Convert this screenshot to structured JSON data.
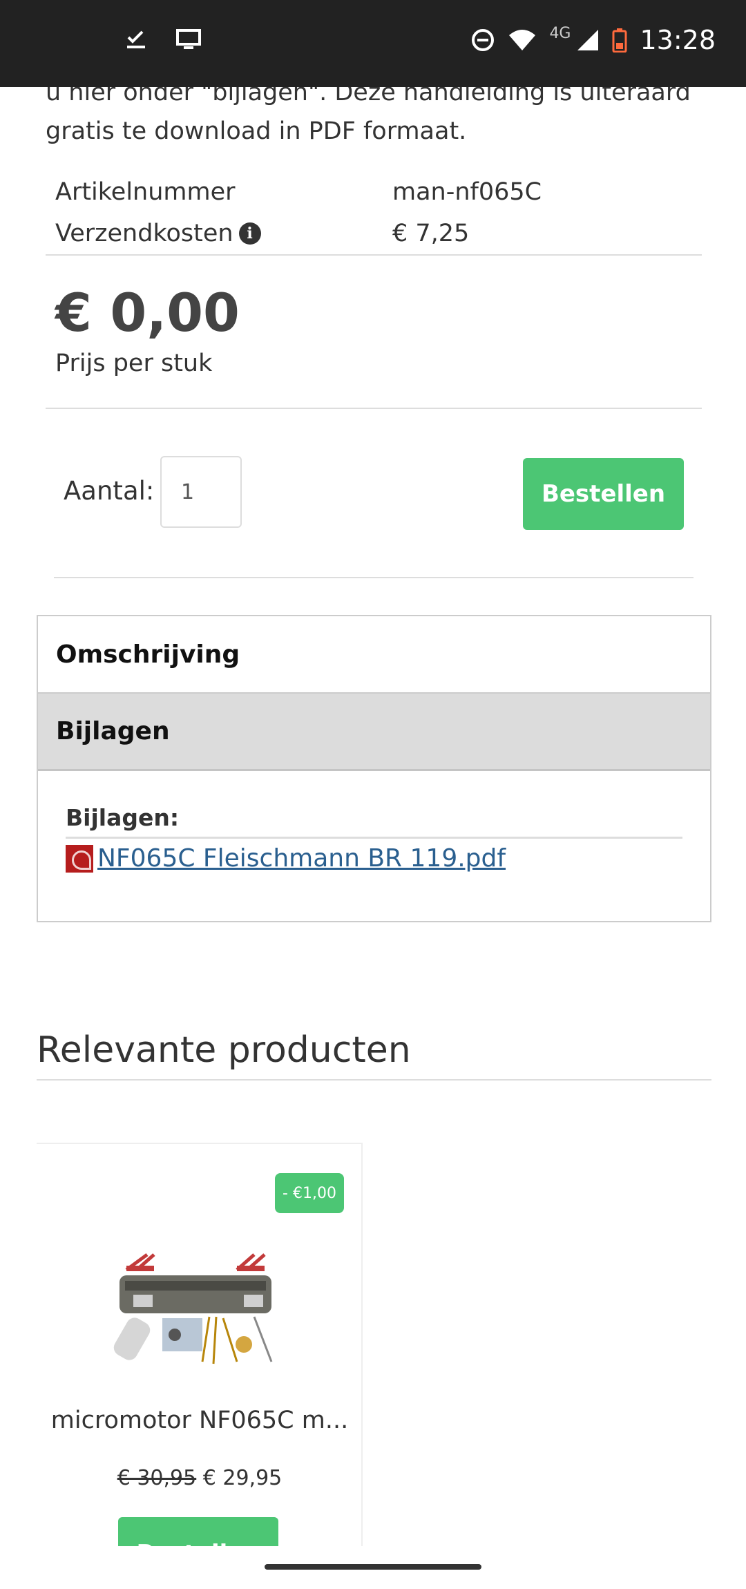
{
  "status_bar": {
    "time": "13:28",
    "network": "4G",
    "left_icons": [
      "check-download-icon",
      "screen-cast-icon"
    ],
    "right_icons": [
      "do-not-disturb-icon",
      "wifi-icon",
      "signal-icon",
      "battery-icon"
    ]
  },
  "intro": {
    "text": "u hier onder \"bijlagen\". Deze handleiding is uiteraard gratis te download in PDF formaat."
  },
  "specs": [
    {
      "label": "Artikelnummer",
      "value": "man-nf065C"
    },
    {
      "label": "Verzendkosten",
      "value": "€ 7,25"
    }
  ],
  "pricing": {
    "price": "€ 0,00",
    "subtitle": "Prijs per stuk"
  },
  "order": {
    "qty_label": "Aantal:",
    "qty_value": "1",
    "button_label": "Bestellen"
  },
  "tabs": {
    "description": "Omschrijving",
    "attachments": "Bijlagen"
  },
  "attachments": {
    "title": "Bijlagen:",
    "files": [
      "NF065C Fleischmann BR 119.pdf"
    ]
  },
  "related": {
    "title": "Relevante producten",
    "products": [
      {
        "badge": "- €1,00",
        "name": "micromotor NF065C m...",
        "old_price": "€ 30,95",
        "price": "€ 29,95",
        "button_label": "Bestellen"
      }
    ]
  },
  "colors": {
    "accent": "#4cc674",
    "link": "#2a5f8f",
    "status_bar": "#222222"
  }
}
